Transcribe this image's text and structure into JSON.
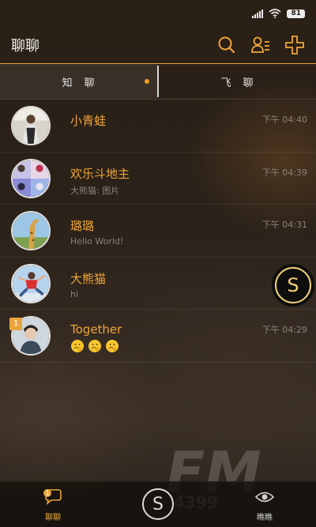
{
  "status": {
    "battery": "81"
  },
  "header": {
    "title": "聊聊"
  },
  "tabs": [
    {
      "label": "知　聊",
      "active": true,
      "dot": true
    },
    {
      "label": "飞　聊",
      "active": false,
      "dot": false
    }
  ],
  "chats": [
    {
      "name": "小青蛙",
      "message": "",
      "time": "下午 04:40"
    },
    {
      "name": "欢乐斗地主",
      "message": "大熊猫: 图片",
      "time": "下午 04:39"
    },
    {
      "name": "璐璐",
      "message": "Hello World!",
      "time": "下午 04:31"
    },
    {
      "name": "大熊猫",
      "message": "hi",
      "time": "下"
    },
    {
      "name": "Together",
      "message": "",
      "time": "下午 04:29",
      "unread": "1",
      "emoji_count": 3
    }
  ],
  "float_button": {
    "label": "S"
  },
  "bottom_nav": {
    "left": {
      "label": "聊聊",
      "badge": "1"
    },
    "center": {
      "label": "S"
    },
    "right": {
      "label": "瞧瞧"
    }
  },
  "watermark": {
    "big": "FM",
    "small": "4399"
  },
  "colors": {
    "accent": "#f0a63a",
    "muted": "#8a837c",
    "tab_border": "#e9a53a"
  }
}
